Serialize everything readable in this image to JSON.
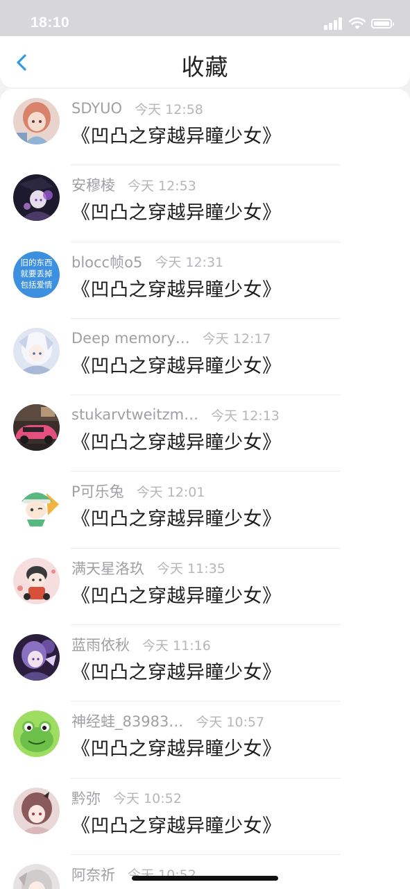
{
  "status_bar": {
    "time": "18:10"
  },
  "header": {
    "title": "收藏",
    "back_icon": "chevron-left-icon"
  },
  "colors": {
    "accent": "#2f9be6",
    "title": "#222222",
    "username": "#a0a0a4",
    "timestamp": "#b6b6ba"
  },
  "items": [
    {
      "username": "SDYUO",
      "time": "今天 12:58",
      "title": "《凹凸之穿越异瞳少女》",
      "avatar": "anime-girl-orange-hair-avatar"
    },
    {
      "username": "安穆棱",
      "time": "今天 12:53",
      "title": "《凹凸之穿越异瞳少女》",
      "avatar": "dark-purple-anime-avatar"
    },
    {
      "username": "blocc帧o5",
      "time": "今天 12:31",
      "title": "《凹凸之穿越异瞳少女》",
      "avatar": "blue-text-avatar",
      "avatar_text": [
        "旧的东西",
        "就要丢掉",
        "包括爱情"
      ]
    },
    {
      "username": "Deep memory…",
      "time": "今天 12:17",
      "title": "《凹凸之穿越异瞳少女》",
      "avatar": "white-hair-anime-avatar"
    },
    {
      "username": "stukarvtweitzm…",
      "time": "今天 12:13",
      "title": "《凹凸之穿越异瞳少女》",
      "avatar": "pink-car-avatar"
    },
    {
      "username": "P可乐兔",
      "time": "今天 12:01",
      "title": "《凹凸之穿越异瞳少女》",
      "avatar": "chibi-green-hat-avatar"
    },
    {
      "username": "满天星洛玖",
      "time": "今天 11:35",
      "title": "《凹凸之穿越异瞳少女》",
      "avatar": "chibi-boy-avatar"
    },
    {
      "username": "蓝雨依秋",
      "time": "今天 11:16",
      "title": "《凹凸之穿越异瞳少女》",
      "avatar": "purple-anime-girl-avatar"
    },
    {
      "username": "神经蛙_83983…",
      "time": "今天 10:57",
      "title": "《凹凸之穿越异瞳少女》",
      "avatar": "green-frog-avatar"
    },
    {
      "username": "黔弥",
      "time": "今天 10:52",
      "title": "《凹凸之穿越异瞳少女》",
      "avatar": "brown-hair-anime-avatar"
    },
    {
      "username": "阿奈祈",
      "time": "今天 10:52",
      "title": "",
      "avatar": "silver-hair-anime-avatar"
    }
  ]
}
